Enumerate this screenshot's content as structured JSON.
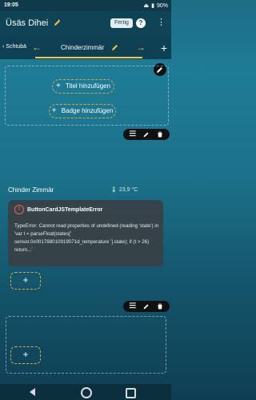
{
  "status_bar": {
    "time": "19:05",
    "battery": "90%"
  },
  "app_bar": {
    "title": "Üsäs Dihei",
    "done_label": "Fertig",
    "help_label": "?"
  },
  "tabs": {
    "back_label": "Schtubä",
    "active_label": "Chinderzimmär"
  },
  "panel1": {
    "add_title_label": "Titel hinzufügen",
    "add_badge_label": "Badge hinzufügen"
  },
  "room": {
    "name": "Chinder Zimmär",
    "temperature": "23,9 °C"
  },
  "error_card": {
    "title": "ButtonCardJSTemplateError",
    "message": "TypeError: Cannot read properties of undefined (reading 'state') in 'var t = parseFloat(states[' sensor.0x001788010919071d_temperature '].state); if (t > 26) return...'"
  },
  "icons": {
    "edit": "pencil-icon",
    "delete": "trash-icon",
    "drag": "drag-handle-icon",
    "add": "plus-icon",
    "back": "back-triangle-icon",
    "home": "home-circle-icon",
    "recent": "recent-apps-icon"
  }
}
